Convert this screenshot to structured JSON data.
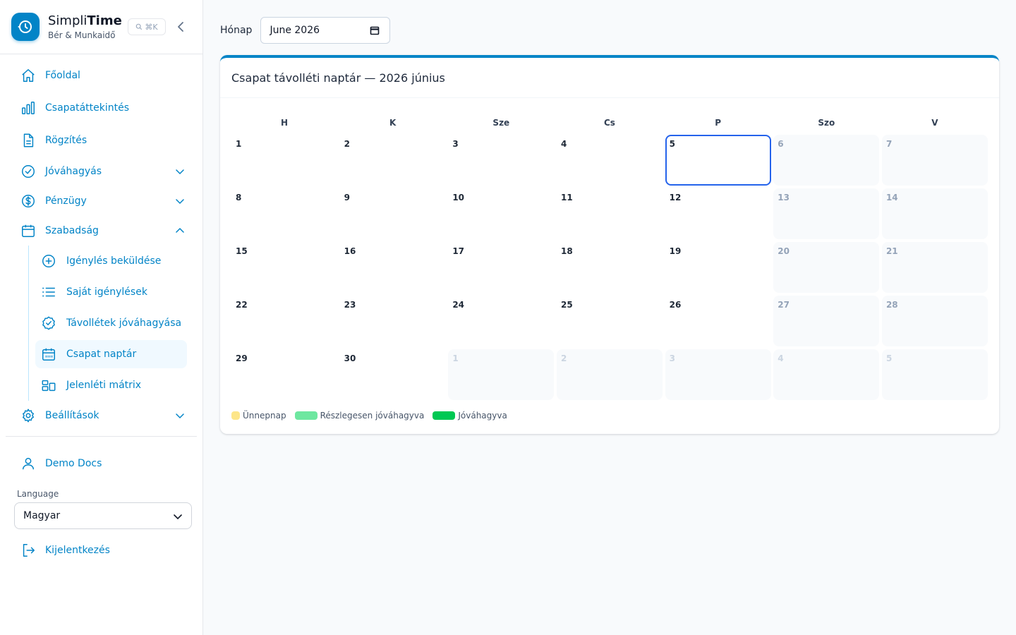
{
  "brand": {
    "name_light": "Simpli",
    "name_bold": "Time",
    "subtitle": "Bér & Munkaidő",
    "shortcut": "⌘K"
  },
  "nav": {
    "home": "Főoldal",
    "team_overview": "Csapatáttekintés",
    "record": "Rögzítés",
    "approval": "Jóváhagyás",
    "finance": "Pénzügy",
    "leave": "Szabadság",
    "leave_sub": {
      "submit": "Igénylés beküldése",
      "mine": "Saját igénylések",
      "approve": "Távollétek jóváhagyása",
      "calendar": "Csapat naptár",
      "matrix": "Jelenléti mátrix"
    },
    "settings": "Beállítások"
  },
  "user": {
    "name": "Demo Docs"
  },
  "language": {
    "label": "Language",
    "selected": "Magyar"
  },
  "logout": "Kijelentkezés",
  "month_picker": {
    "label": "Hónap",
    "value": "June 2026"
  },
  "calendar": {
    "title": "Csapat távolléti naptár — 2026 június",
    "weekdays": [
      "H",
      "K",
      "Sze",
      "Cs",
      "P",
      "Szo",
      "V"
    ],
    "today": "5",
    "weeks": [
      [
        {
          "d": "1",
          "t": "day"
        },
        {
          "d": "2",
          "t": "day"
        },
        {
          "d": "3",
          "t": "day"
        },
        {
          "d": "4",
          "t": "day"
        },
        {
          "d": "5",
          "t": "today"
        },
        {
          "d": "6",
          "t": "weekend"
        },
        {
          "d": "7",
          "t": "weekend"
        }
      ],
      [
        {
          "d": "8",
          "t": "day"
        },
        {
          "d": "9",
          "t": "day"
        },
        {
          "d": "10",
          "t": "day"
        },
        {
          "d": "11",
          "t": "day"
        },
        {
          "d": "12",
          "t": "day"
        },
        {
          "d": "13",
          "t": "weekend"
        },
        {
          "d": "14",
          "t": "weekend"
        }
      ],
      [
        {
          "d": "15",
          "t": "day"
        },
        {
          "d": "16",
          "t": "day"
        },
        {
          "d": "17",
          "t": "day"
        },
        {
          "d": "18",
          "t": "day"
        },
        {
          "d": "19",
          "t": "day"
        },
        {
          "d": "20",
          "t": "weekend"
        },
        {
          "d": "21",
          "t": "weekend"
        }
      ],
      [
        {
          "d": "22",
          "t": "day"
        },
        {
          "d": "23",
          "t": "day"
        },
        {
          "d": "24",
          "t": "day"
        },
        {
          "d": "25",
          "t": "day"
        },
        {
          "d": "26",
          "t": "day"
        },
        {
          "d": "27",
          "t": "weekend"
        },
        {
          "d": "28",
          "t": "weekend"
        }
      ],
      [
        {
          "d": "29",
          "t": "day"
        },
        {
          "d": "30",
          "t": "day"
        },
        {
          "d": "1",
          "t": "other"
        },
        {
          "d": "2",
          "t": "other"
        },
        {
          "d": "3",
          "t": "other"
        },
        {
          "d": "4",
          "t": "other"
        },
        {
          "d": "5",
          "t": "other"
        }
      ]
    ],
    "legend": [
      {
        "label": "Ünnepnap",
        "color": "#fde68a"
      },
      {
        "label": "Részlegesen jóváhagyva",
        "color": "#6ee7a0"
      },
      {
        "label": "Jóváhagyva",
        "color": "#00c853"
      }
    ]
  },
  "colors": {
    "accent": "#0284c7",
    "today_border": "#2563eb"
  }
}
